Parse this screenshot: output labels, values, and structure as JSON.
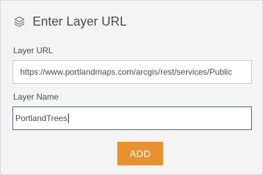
{
  "header": {
    "title": "Enter Layer URL",
    "icon": "layers-icon"
  },
  "layer_url": {
    "label": "Layer URL",
    "value": "https://www.portlandmaps.com/arcgis/rest/services/Public"
  },
  "layer_name": {
    "label": "Layer Name",
    "value": "PortlandTrees"
  },
  "actions": {
    "add_label": "ADD",
    "add_color": "#e8912e"
  },
  "colors": {
    "background": "#f4f4f4",
    "focus_border": "#3e5f8a",
    "text": "#4a4a4a"
  }
}
